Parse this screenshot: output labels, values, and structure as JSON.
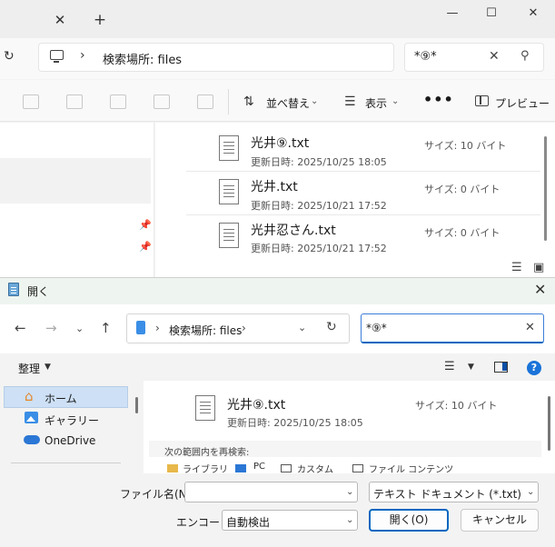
{
  "explorer": {
    "tab_close": "✕",
    "tab_add": "+",
    "window_buttons": [
      "—",
      "☐",
      "✕"
    ],
    "address_path": "検索場所: files",
    "address_chevron": "›",
    "search_value": "*⑨*",
    "toolbar": {
      "sort_label": "並べ替え",
      "view_label": "表示",
      "more_label": "•••",
      "preview_label": "プレビュー"
    },
    "files": [
      {
        "name": "光井⑨.txt",
        "date": "更新日時: 2025/10/25 18:05",
        "size": "サイズ: 10 バイト"
      },
      {
        "name": "光井.txt",
        "date": "更新日時: 2025/10/21 17:52",
        "size": "サイズ: 0 バイト"
      },
      {
        "name": "光井忍さん.txt",
        "date": "更新日時: 2025/10/21 17:52",
        "size": "サイズ: 0 バイト"
      }
    ]
  },
  "dialog": {
    "title": "開く",
    "address_path": "検索場所: files",
    "search_value": "*⑨*",
    "organize_label": "整理",
    "help_label": "?",
    "nav": [
      {
        "label": "ホーム",
        "icon": "home-icon"
      },
      {
        "label": "ギャラリー",
        "icon": "gallery-icon"
      },
      {
        "label": "OneDrive",
        "icon": "onedrive-icon"
      }
    ],
    "file": {
      "name": "光井⑨.txt",
      "date": "更新日時: 2025/10/25 18:05",
      "size": "サイズ: 10 バイト"
    },
    "search_again_label": "次の範囲内を再検索:",
    "locations": [
      "ライブラリ",
      "PC",
      "カスタム",
      "ファイル コンテンツ"
    ],
    "filename_label": "ファイル名(N):",
    "filename_value": "",
    "filetype_value": "テキスト ドキュメント (*.txt)",
    "encoding_label": "エンコード:",
    "encoding_value": "自動検出",
    "open_button": "開く(O)",
    "cancel_button": "キャンセル"
  },
  "colors": {
    "accent": "#0067c0",
    "dialog_title_bg": "#eef5f0",
    "nav_selected": "#cde0f5"
  }
}
